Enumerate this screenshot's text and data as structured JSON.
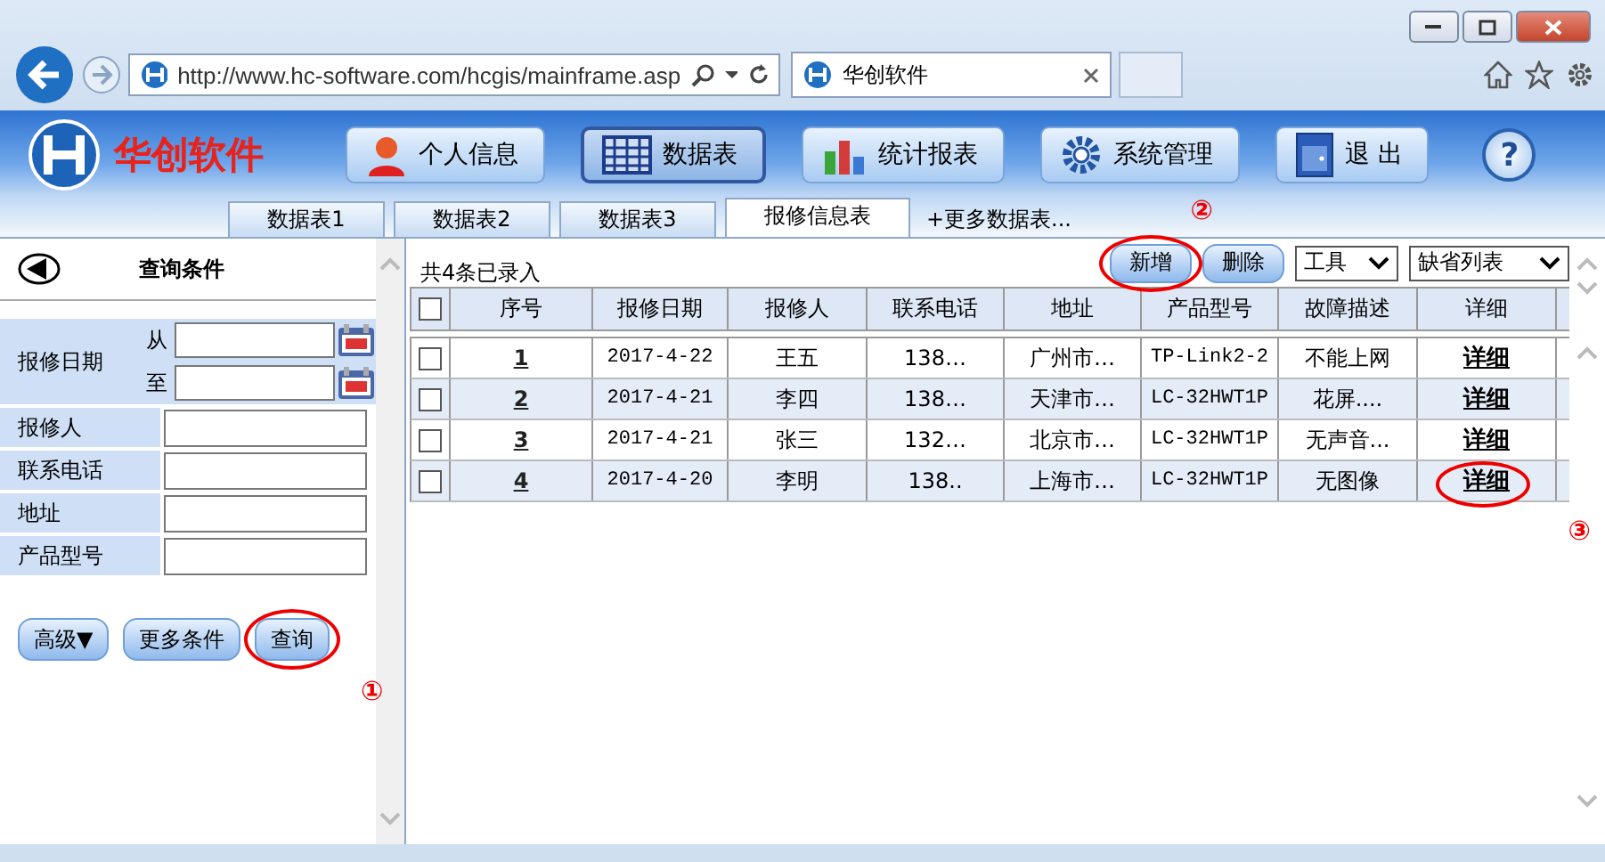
{
  "browser": {
    "address": "http://www.hc-software.com/hcgis/mainframe.asp",
    "tab_title": "华创软件"
  },
  "app": {
    "brand": "华创软件",
    "nav": [
      {
        "label": "个人信息",
        "kind": "person",
        "selected": false
      },
      {
        "label": "数据表",
        "kind": "grid",
        "selected": true
      },
      {
        "label": "统计报表",
        "kind": "chart",
        "selected": false
      },
      {
        "label": "系统管理",
        "kind": "gear",
        "selected": false
      },
      {
        "label": "退 出",
        "kind": "exit",
        "selected": false
      }
    ],
    "help": "?"
  },
  "tabs": [
    {
      "label": "数据表1",
      "selected": false
    },
    {
      "label": "数据表2",
      "selected": false
    },
    {
      "label": "数据表3",
      "selected": false
    },
    {
      "label": "报修信息表",
      "selected": true
    }
  ],
  "more_tabs": "+更多数据表...",
  "query": {
    "title": "查询条件",
    "date_label": "报修日期",
    "from": "从",
    "to": "至",
    "fields": [
      "报修人",
      "联系电话",
      "地址",
      "产品型号"
    ],
    "buttons": [
      {
        "label": "高级▼"
      },
      {
        "label": "更多条件"
      },
      {
        "label": "查询",
        "note": "①"
      }
    ]
  },
  "table": {
    "count": "共4条已录入",
    "all_checked": false,
    "actions": [
      {
        "label": "新增",
        "note": "②"
      },
      {
        "label": "删除"
      }
    ],
    "selects": [
      "工具",
      "缺省列表"
    ],
    "columns": [
      "序号",
      "报修日期",
      "报修人",
      "联系电话",
      "地址",
      "产品型号",
      "故障描述",
      "详细"
    ],
    "rows": [
      {
        "checked": false,
        "no": "1",
        "date": "2017-4-22",
        "person": "王五",
        "phone": "138…",
        "address": "广州市…",
        "model": "TP-Link2-2",
        "fault": "不能上网",
        "detail": "详细"
      },
      {
        "checked": false,
        "no": "2",
        "date": "2017-4-21",
        "person": "李四",
        "phone": "138…",
        "address": "天津市…",
        "model": "LC-32HWT1P",
        "fault": "花屏....",
        "detail": "详细"
      },
      {
        "checked": false,
        "no": "3",
        "date": "2017-4-21",
        "person": "张三",
        "phone": "132…",
        "address": "北京市…",
        "model": "LC-32HWT1P",
        "fault": "无声音...",
        "detail": "详细"
      },
      {
        "checked": false,
        "no": "4",
        "date": "2017-4-20",
        "person": "李明",
        "phone": "138..",
        "address": "上海市…",
        "model": "LC-32HWT1P",
        "fault": "无图像",
        "detail": "详细",
        "note": "③"
      }
    ]
  }
}
